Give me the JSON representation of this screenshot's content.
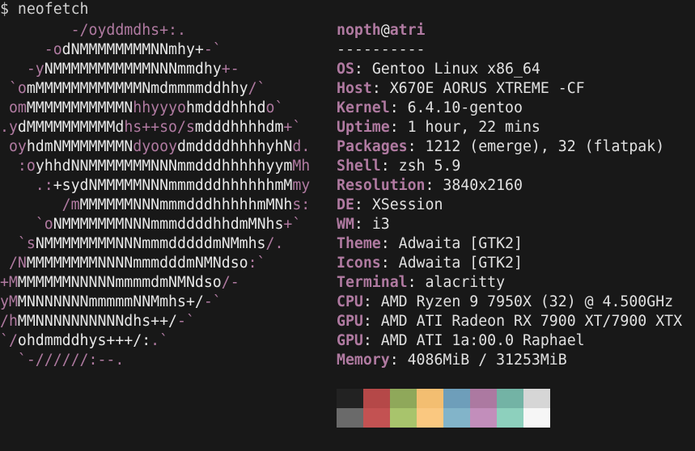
{
  "prompt": {
    "symbol": "$",
    "command": "neofetch"
  },
  "logo_lines": [
    [
      [
        "w",
        "        "
      ],
      [
        "m",
        "-/oyddmdhs+:."
      ]
    ],
    [
      [
        "w",
        "     "
      ],
      [
        "m",
        "-o"
      ],
      [
        "w",
        "dNMMMMMMMMNNmhy+"
      ],
      [
        "m",
        "-`"
      ]
    ],
    [
      [
        "w",
        "   "
      ],
      [
        "m",
        "-y"
      ],
      [
        "w",
        "NMMMMMMMMMMMNNNmmdhy"
      ],
      [
        "m",
        "+-"
      ]
    ],
    [
      [
        "m",
        " `o"
      ],
      [
        "w",
        "mMMMMMMMMMMMMNmdmmmmddhhy"
      ],
      [
        "m",
        "/`"
      ]
    ],
    [
      [
        "m",
        " om"
      ],
      [
        "w",
        "MMMMMMMMMMMN"
      ],
      [
        "m",
        "hhyyyo"
      ],
      [
        "w",
        "hmdddhhhd"
      ],
      [
        "m",
        "o`"
      ]
    ],
    [
      [
        "m",
        ".y"
      ],
      [
        "w",
        "dMMMMMMMMMMd"
      ],
      [
        "m",
        "hs++so/s"
      ],
      [
        "w",
        "mdddhhhhdm"
      ],
      [
        "m",
        "+`"
      ]
    ],
    [
      [
        "m",
        " oy"
      ],
      [
        "w",
        "hdmNMMMMMMMN"
      ],
      [
        "m",
        "dyooy"
      ],
      [
        "w",
        "dmddddhhhhyhN"
      ],
      [
        "m",
        "d."
      ]
    ],
    [
      [
        "m",
        "  :o"
      ],
      [
        "w",
        "yhhdNNMMMMMMMNNNmmdddhhhhhyym"
      ],
      [
        "m",
        "Mh"
      ]
    ],
    [
      [
        "m",
        "    .:"
      ],
      [
        "w",
        "+sydNMMMMMNNNmmmdddhhhhhhmM"
      ],
      [
        "m",
        "my"
      ]
    ],
    [
      [
        "w",
        "       "
      ],
      [
        "m",
        "/m"
      ],
      [
        "w",
        "MMMMMMNNNmmmdddhhhhhmMNh"
      ],
      [
        "m",
        "s:"
      ]
    ],
    [
      [
        "w",
        "    "
      ],
      [
        "m",
        "`o"
      ],
      [
        "w",
        "NMMMMMMMNNNmmmddddhhdmMNhs"
      ],
      [
        "m",
        "+`"
      ]
    ],
    [
      [
        "w",
        "  "
      ],
      [
        "m",
        "`s"
      ],
      [
        "w",
        "NMMMMMMMMNNNmmmdddddmNMmhs"
      ],
      [
        "m",
        "/."
      ]
    ],
    [
      [
        "m",
        " /N"
      ],
      [
        "w",
        "MMMMMMMMNNNNmmmdddmNMNdso"
      ],
      [
        "m",
        ":`"
      ]
    ],
    [
      [
        "m",
        "+M"
      ],
      [
        "w",
        "MMMMMMNNNNNmmmmdmNMNdso"
      ],
      [
        "m",
        "/-"
      ]
    ],
    [
      [
        "m",
        "yM"
      ],
      [
        "w",
        "MNNNNNNNmmmmmNNMmhs+/"
      ],
      [
        "m",
        "-`"
      ]
    ],
    [
      [
        "m",
        "/h"
      ],
      [
        "w",
        "MMNNNNNNNNNNdhs++/"
      ],
      [
        "m",
        "-`"
      ]
    ],
    [
      [
        "m",
        "`/"
      ],
      [
        "w",
        "ohdmmddhys+++/:"
      ],
      [
        "m",
        ".`"
      ]
    ],
    [
      [
        "w",
        "  "
      ],
      [
        "m",
        "`-//////:--."
      ]
    ]
  ],
  "header": {
    "user": "nopth",
    "at": "@",
    "host": "atri",
    "separator": "----------"
  },
  "info": [
    {
      "key": "OS",
      "value": "Gentoo Linux x86_64"
    },
    {
      "key": "Host",
      "value": "X670E AORUS XTREME -CF"
    },
    {
      "key": "Kernel",
      "value": "6.4.10-gentoo"
    },
    {
      "key": "Uptime",
      "value": "1 hour, 22 mins"
    },
    {
      "key": "Packages",
      "value": "1212 (emerge), 32 (flatpak)"
    },
    {
      "key": "Shell",
      "value": "zsh 5.9"
    },
    {
      "key": "Resolution",
      "value": "3840x2160"
    },
    {
      "key": "DE",
      "value": "XSession"
    },
    {
      "key": "WM",
      "value": "i3"
    },
    {
      "key": "Theme",
      "value": "Adwaita [GTK2]"
    },
    {
      "key": "Icons",
      "value": "Adwaita [GTK2]"
    },
    {
      "key": "Terminal",
      "value": "alacritty"
    },
    {
      "key": "CPU",
      "value": "AMD Ryzen 9 7950X (32) @ 4.500GHz"
    },
    {
      "key": "GPU",
      "value": "AMD ATI Radeon RX 7900 XT/7900 XTX"
    },
    {
      "key": "GPU",
      "value": "AMD ATI 1a:00.0 Raphael"
    },
    {
      "key": "Memory",
      "value": "4086MiB / 31253MiB"
    }
  ],
  "palette": {
    "normal": [
      "#222222",
      "#b54848",
      "#8fa85a",
      "#f3be71",
      "#6e9eba",
      "#ac79a1",
      "#73b3a5",
      "#d6d6d6"
    ],
    "bright": [
      "#6a6a6a",
      "#c35252",
      "#a8c46c",
      "#fac880",
      "#82b4c9",
      "#c28ebb",
      "#8dd0bd",
      "#f6f6f6"
    ]
  },
  "colors": {
    "background": "#181818",
    "accent": "#b07aa1",
    "foreground": "#e0e0e0"
  }
}
